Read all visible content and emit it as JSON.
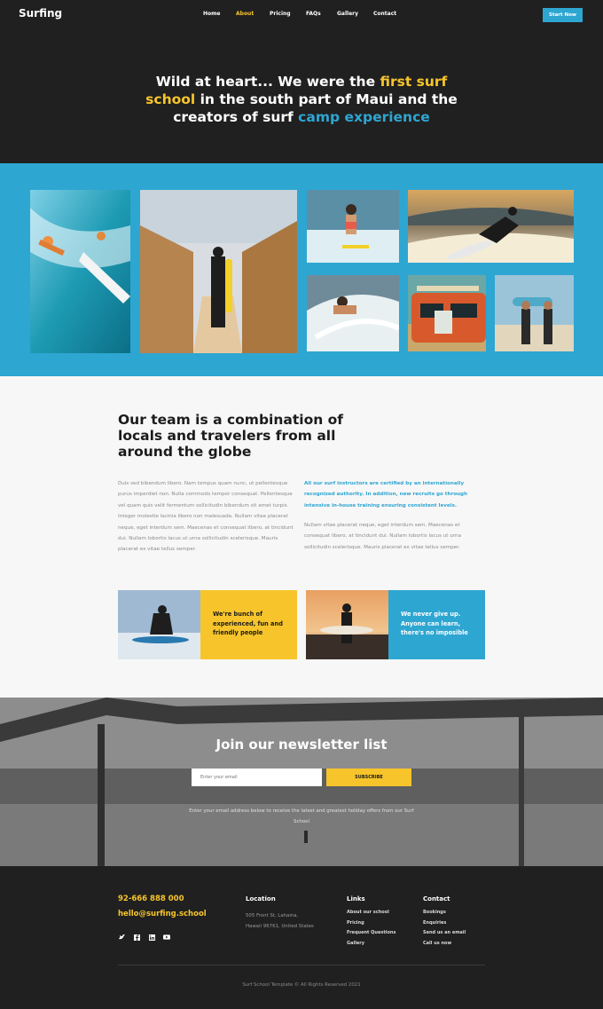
{
  "brand": {
    "logo": "Surfing"
  },
  "nav": {
    "items": [
      "Home",
      "About",
      "Pricing",
      "FAQs",
      "Gallery",
      "Contact"
    ],
    "active": "About",
    "cta": "Start Now"
  },
  "hero": {
    "part1": "Wild at heart... We were the ",
    "highlight1": "first surf school",
    "part2": " in the south part of Maui and the creators of surf ",
    "highlight2": "camp experience"
  },
  "team": {
    "title": "Our team is a combination of locals and travelers from all around the globe",
    "left_paragraph": "Duis sed bibendum libero. Nam tempus quam nunc, ut pellentesque purus imperdiet non. Nulla commodo tempor consequat. Pellentesque vel quam quis velit fermentum sollicitudin bibendum sit amet turpis. Integer molestie lacinia libero non malesuada. Nullam vitae placerat neque, eget interdum sem. Maecenas et consequat libero, at tincidunt dui. Nullam lobortis lacus ut urna sollicitudin scelerisque. Mauris placerat ex vitae tellus semper.",
    "right_highlight": "All our surf instructors are certified by an internationally recognized authority. In addition, new recruits go through intensive in-house training ensuring consistent levels.",
    "right_paragraph": "Nullam vitae placerat neque, eget interdum sem. Maecenas et consequat libero, at tincidunt dui. Nullam lobortis lacus ut urna sollicitudin scelerisque. Mauris placerat ex vitae tellus semper.",
    "card1": "We're bunch of experienced, fun and friendly people",
    "card2": "We never give up. Anyone can learn, there's no imposible"
  },
  "newsletter": {
    "title": "Join our newsletter list",
    "placeholder": "Enter your email",
    "button": "SUBSCRIBE",
    "note": "Enter your email address below to receive the latest and greatest holiday offers from our Surf School"
  },
  "footer": {
    "phone": "92-666 888 000",
    "email": "hello@surfing.school",
    "location_title": "Location",
    "address_line1": "505 Front St, Lahaina,",
    "address_line2": "Hawaii 96761, United States",
    "links_title": "Links",
    "links": [
      "About our school",
      "Pricing",
      "Frequent Questions",
      "Gallery"
    ],
    "contact_title": "Contact",
    "contact_links": [
      "Bookings",
      "Enquiries",
      "Send us an email",
      "Call us now"
    ],
    "socials": [
      "twitter-icon",
      "facebook-icon",
      "linkedin-icon",
      "youtube-icon"
    ],
    "copyright": "Surf School Template  © All Rights Reserved 2021"
  },
  "colors": {
    "accent_yellow": "#f7c52b",
    "accent_blue": "#2ea6d2",
    "dark": "#202020",
    "light_bg": "#f7f7f7"
  }
}
